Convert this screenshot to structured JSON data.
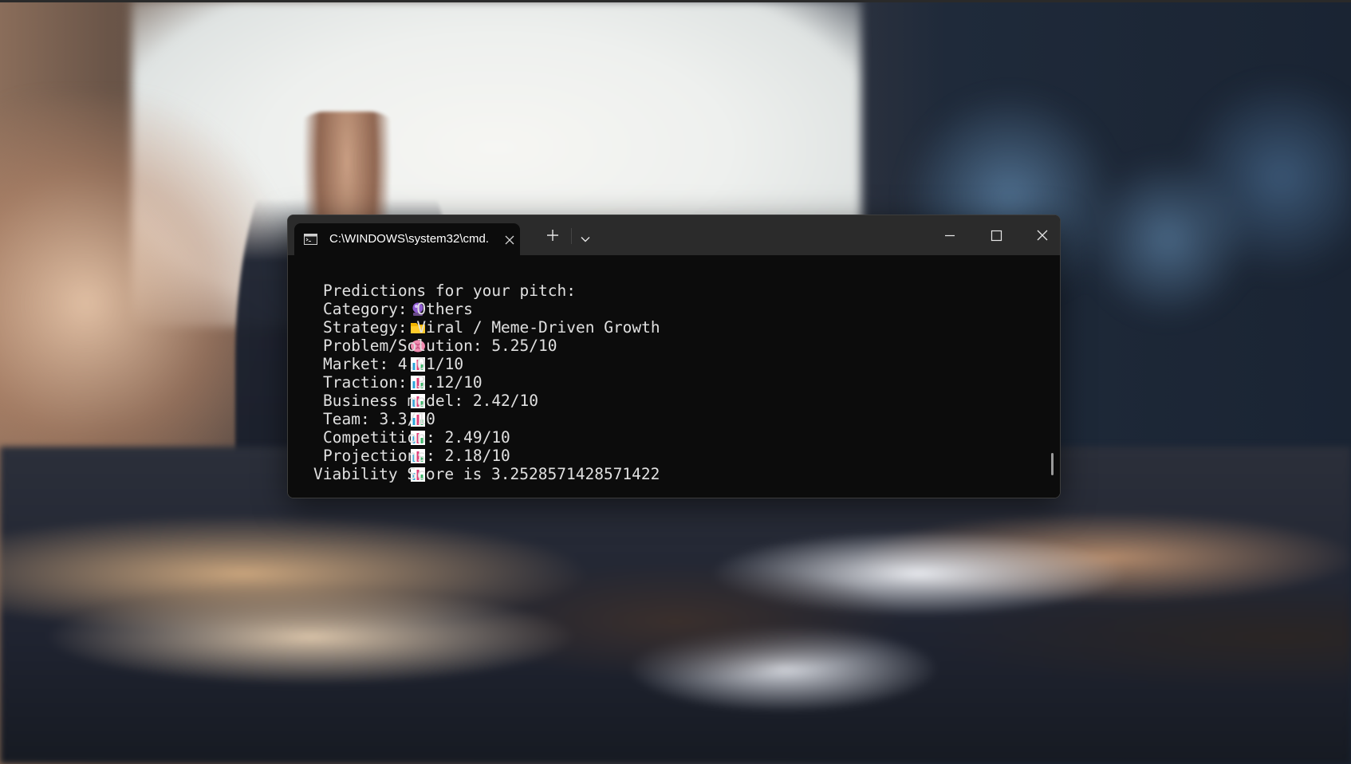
{
  "terminal": {
    "tab_title": "C:\\WINDOWS\\system32\\cmd.",
    "tab_icon": "cmd-icon",
    "new_tab_icon": "plus-icon",
    "dropdown_icon": "chevron-down-icon",
    "window_controls": [
      "minimize-icon",
      "maximize-icon",
      "close-icon"
    ]
  },
  "output": {
    "lines": [
      {
        "icon": "crystal-ball-icon",
        "text": "Predictions for your pitch:"
      },
      {
        "icon": "folder-icon",
        "text": "Category: Others"
      },
      {
        "icon": "brain-icon",
        "text": "Strategy: Viral / Meme-Driven Growth"
      },
      {
        "icon": "bar-chart-icon",
        "text": "Problem/Solution: 5.25/10"
      },
      {
        "icon": "bar-chart-icon",
        "text": "Market: 4.01/10"
      },
      {
        "icon": "bar-chart-icon",
        "text": "Traction: 3.12/10"
      },
      {
        "icon": "bar-chart-icon",
        "text": "Business model: 2.42/10"
      },
      {
        "icon": "bar-chart-icon",
        "text": "Team: 3.3/10"
      },
      {
        "icon": "bar-chart-icon",
        "text": "Competition: 2.49/10"
      },
      {
        "icon": "bar-chart-icon",
        "text": "Projections: 2.18/10"
      },
      {
        "icon": "",
        "text": "Viability Score is 3.2528571428571422"
      }
    ]
  },
  "colors": {
    "console_bg": "#0c0c0c",
    "titlebar_bg": "#2b2b2b",
    "console_text": "#e0e0e0"
  }
}
